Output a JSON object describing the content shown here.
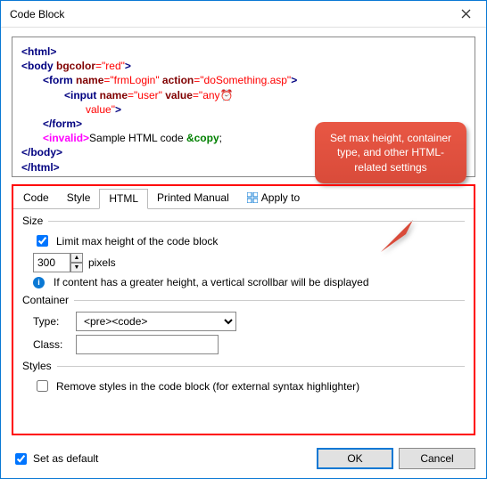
{
  "window": {
    "title": "Code Block"
  },
  "code": {
    "l1a": "<html>",
    "l2a": "<body",
    "l2b": " bgcolor",
    "l2c": "=\"red\"",
    "l2d": ">",
    "l3a": "<form",
    "l3b": " name",
    "l3c": "=\"frmLogin\"",
    "l3d": " action",
    "l3e": "=\"doSomething.asp\"",
    "l3f": ">",
    "l4a": "<input",
    "l4b": " name",
    "l4c": "=\"user\"",
    "l4d": " value",
    "l4e": "=\"any",
    "l4f": "value\"",
    "l4g": ">",
    "l5a": "</form>",
    "l6a": "<invalid>",
    "l6b": "Sample HTML code ",
    "l6c": "&copy",
    "l6d": ";",
    "l7a": "</body>",
    "l8a": "</html>"
  },
  "tabs": {
    "code": "Code",
    "style": "Style",
    "html": "HTML",
    "printed": "Printed Manual",
    "apply": "Apply to"
  },
  "size": {
    "legend": "Size",
    "limit_label": "Limit max height of the code block",
    "limit_checked": true,
    "pixels_value": "300",
    "pixels_label": "pixels",
    "info": "If content has a greater height, a vertical scrollbar will be displayed"
  },
  "container": {
    "legend": "Container",
    "type_label": "Type:",
    "type_value": "<pre><code>",
    "class_label": "Class:",
    "class_value": ""
  },
  "styles": {
    "legend": "Styles",
    "remove_label": "Remove styles in the code block (for external syntax highlighter)",
    "remove_checked": false
  },
  "callout": {
    "text": "Set max height, container type, and other HTML-related settings"
  },
  "footer": {
    "default_label": "Set as default",
    "default_checked": true,
    "ok": "OK",
    "cancel": "Cancel"
  }
}
